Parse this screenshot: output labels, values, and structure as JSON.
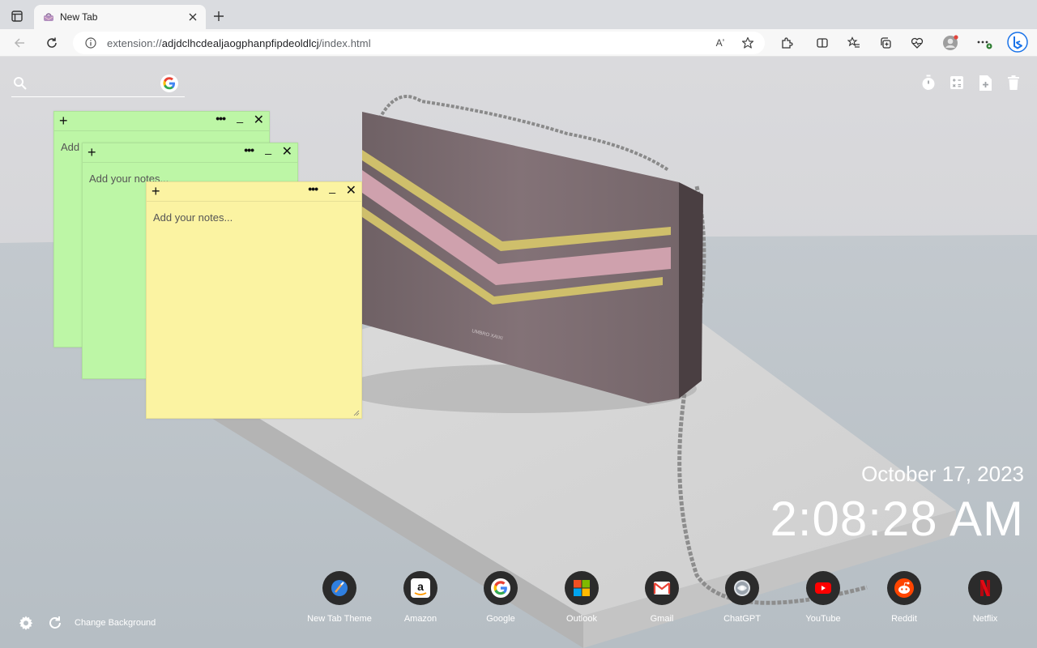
{
  "browser": {
    "tab": {
      "title": "New Tab"
    },
    "address": {
      "scheme": "extension://",
      "host": "adjdclhcdealjaogphanpfipdeoldlcj",
      "path": "/index.html"
    },
    "read_aloud_label": "Aʼ"
  },
  "search": {
    "placeholder": ""
  },
  "notes": [
    {
      "color": "green",
      "add": "+",
      "more": "•••",
      "minimize": "_",
      "close": "✕",
      "text": "Add your notes..."
    },
    {
      "color": "green",
      "add": "+",
      "more": "•••",
      "minimize": "_",
      "close": "✕",
      "text": "Add your notes..."
    },
    {
      "color": "yellow",
      "add": "+",
      "more": "•••",
      "minimize": "_",
      "close": "✕",
      "text": "Add your notes..."
    }
  ],
  "clock": {
    "date": "October 17, 2023",
    "time": "2:08:28 AM"
  },
  "shortcuts": [
    {
      "label": "New Tab Theme",
      "icon": "new-tab-theme-icon"
    },
    {
      "label": "Amazon",
      "icon": "amazon-icon"
    },
    {
      "label": "Google",
      "icon": "google-icon"
    },
    {
      "label": "Outlook",
      "icon": "outlook-icon"
    },
    {
      "label": "Gmail",
      "icon": "gmail-icon"
    },
    {
      "label": "ChatGPT",
      "icon": "chatgpt-icon"
    },
    {
      "label": "YouTube",
      "icon": "youtube-icon"
    },
    {
      "label": "Reddit",
      "icon": "reddit-icon"
    },
    {
      "label": "Netflix",
      "icon": "netflix-icon"
    }
  ],
  "footer": {
    "change_background": "Change Background"
  },
  "product_brand_text": "UMBRO XAIXI",
  "colors": {
    "note_green": "#bdf6a6",
    "note_yellow": "#fbf3a2",
    "bag": "#7f6e72",
    "stripe_pink": "#cfa1ad",
    "stripe_gold": "#cfbf6b",
    "edge_accent": "#1a73e8"
  }
}
